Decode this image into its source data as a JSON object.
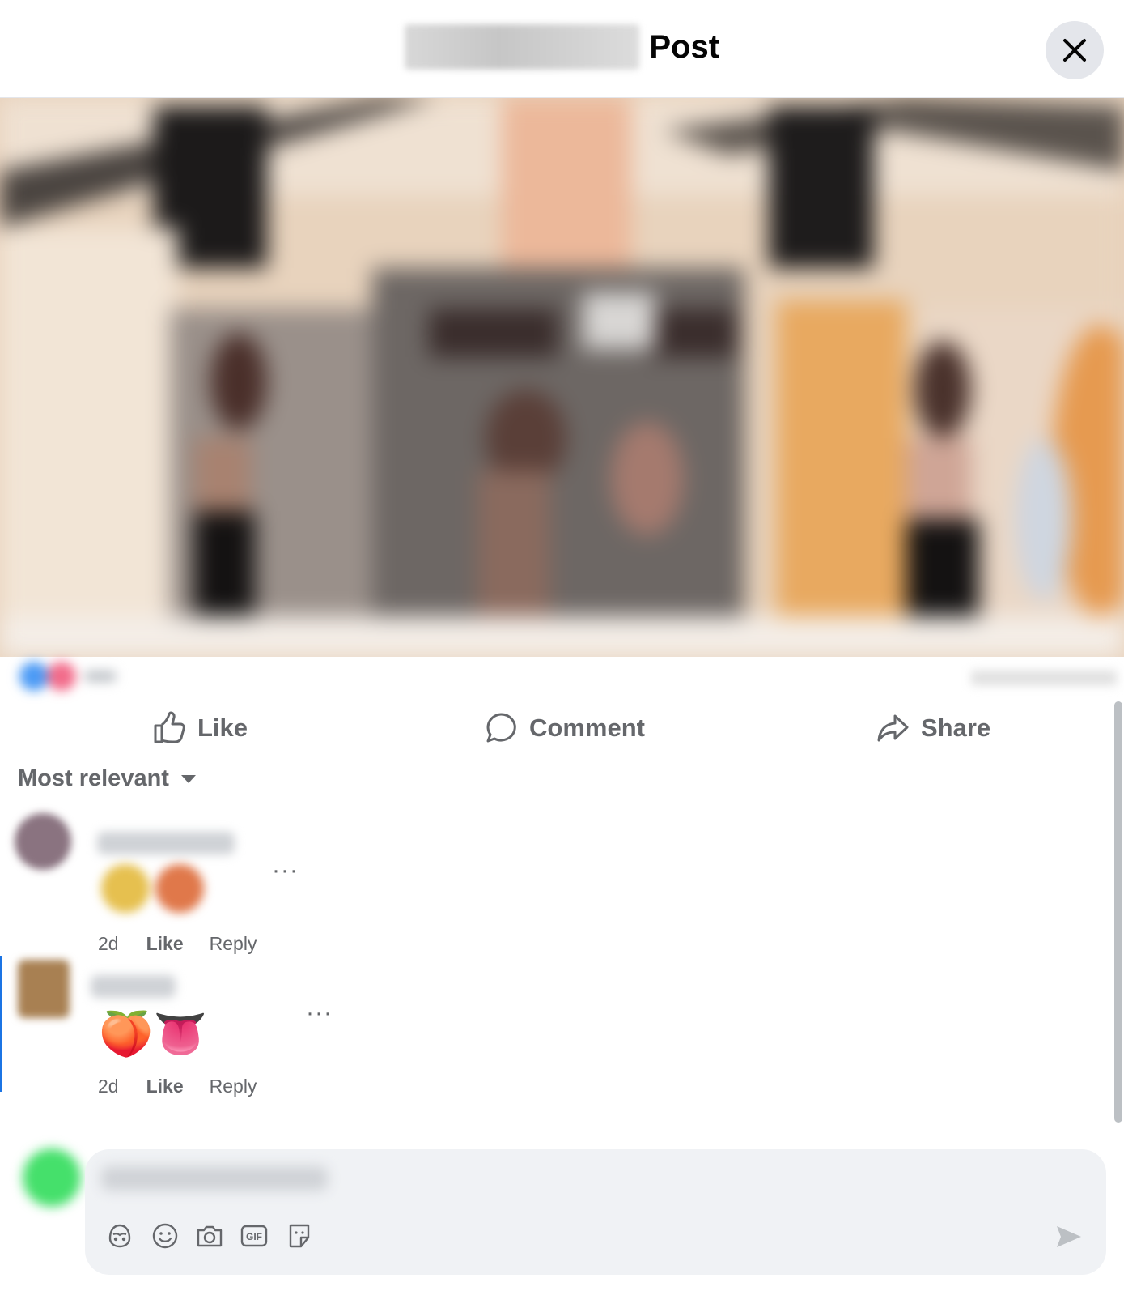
{
  "header": {
    "title": "Post",
    "close_icon": "close-icon"
  },
  "actions": {
    "like_label": "Like",
    "comment_label": "Comment",
    "share_label": "Share"
  },
  "sort": {
    "label": "Most relevant",
    "icon": "caret-down-icon"
  },
  "comments": [
    {
      "time": "2d",
      "like_label": "Like",
      "reply_label": "Reply",
      "more": "···"
    },
    {
      "text": "🍑👅",
      "time": "2d",
      "like_label": "Like",
      "reply_label": "Reply",
      "more": "···"
    }
  ],
  "composer": {
    "tools": [
      "avatar-sticker-icon",
      "emoji-icon",
      "camera-icon",
      "gif-icon",
      "sticker-icon"
    ],
    "send_icon": "send-icon"
  },
  "colors": {
    "secondary_text": "#65676b",
    "composer_bg": "#f0f2f5",
    "close_bg": "#e4e6eb",
    "accent": "#1b74e4"
  }
}
